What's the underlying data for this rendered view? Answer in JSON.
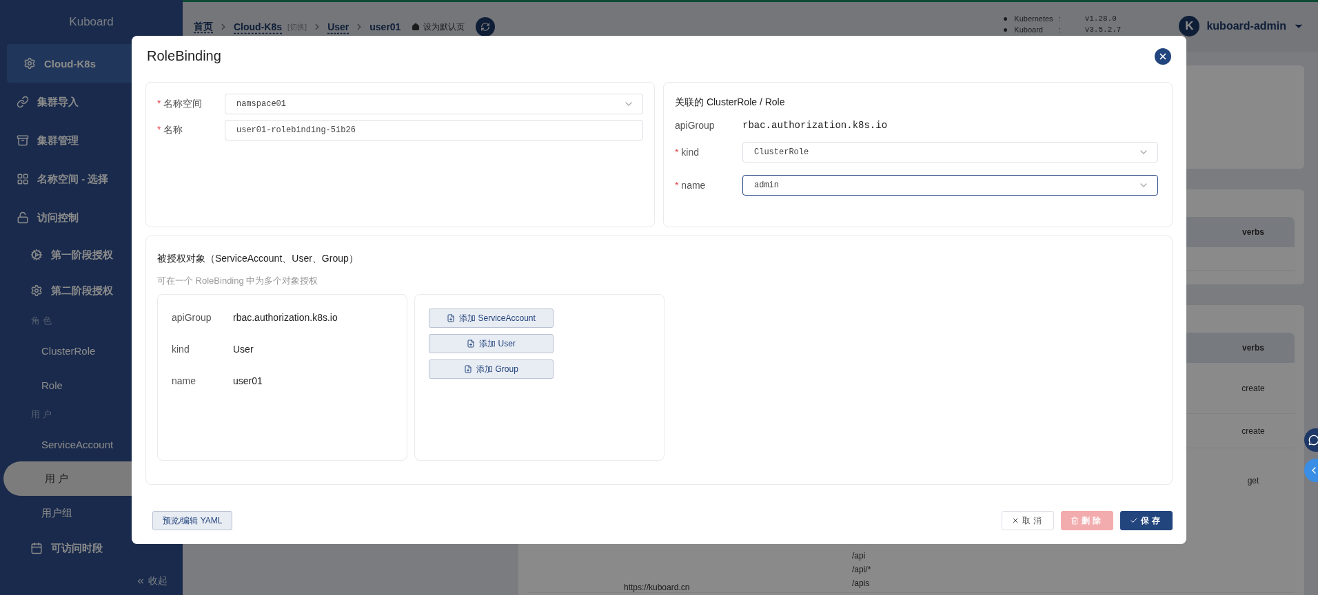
{
  "sidebar": {
    "title": "Kuboard",
    "items": [
      {
        "kind": "section",
        "label": "Cloud-K8s",
        "selected": true
      },
      {
        "kind": "section",
        "label": "集群导入",
        "selected": false
      },
      {
        "kind": "section",
        "label": "集群管理",
        "selected": false
      },
      {
        "kind": "section",
        "label": "名称空间 - 选择",
        "selected": false
      },
      {
        "kind": "section",
        "label": "访问控制",
        "selected": false
      },
      {
        "kind": "sub",
        "label": "第一阶段授权",
        "selected": false
      },
      {
        "kind": "sub",
        "label": "第二阶段授权",
        "selected": false
      },
      {
        "kind": "group",
        "label": "角 色"
      },
      {
        "kind": "leaf",
        "label": "ClusterRole",
        "selected": false
      },
      {
        "kind": "leaf",
        "label": "Role",
        "selected": false
      },
      {
        "kind": "group",
        "label": "用 户"
      },
      {
        "kind": "leaf",
        "label": "ServiceAccount",
        "selected": false
      },
      {
        "kind": "leaf",
        "label": "用 户",
        "selected": true
      },
      {
        "kind": "leaf",
        "label": "用户组",
        "selected": false
      },
      {
        "kind": "sub",
        "label": "可访问时段",
        "selected": false
      }
    ],
    "collapse": "收起"
  },
  "topbar": {
    "breadcrumb": [
      {
        "label": "首页",
        "current": false
      },
      {
        "label": "Cloud-K8s",
        "tag": "[切换]",
        "current": false
      },
      {
        "label": "User",
        "current": false
      },
      {
        "label": "user01",
        "current": true
      }
    ],
    "set_default": "设为默认页",
    "versions": [
      {
        "name": "Kubernetes",
        "sep": ":",
        "value": "v1.28.0"
      },
      {
        "name": "Kuboard",
        "sep": ":",
        "value": "v3.5.2.7"
      }
    ],
    "user": {
      "initial": "K",
      "name": "kuboard-admin"
    }
  },
  "background": {
    "tables": [
      {
        "header": "verbs"
      },
      {
        "header": "verbs",
        "rows": [
          {
            "verb": "create"
          },
          {
            "verb": "create"
          },
          {
            "verb": "get",
            "resources": [
              "/api",
              "/api/*",
              "/apis"
            ]
          }
        ]
      }
    ],
    "footer": "https://kuboard.cn"
  },
  "dialog": {
    "title": "RoleBinding",
    "meta_fields": [
      {
        "mark": "*",
        "label": "名称空间",
        "kind": "select",
        "value": "namspace01",
        "focused": false
      },
      {
        "mark": "*",
        "label": "名称",
        "kind": "input",
        "value": "user01-rolebinding-5ib26",
        "focused": false
      }
    ],
    "role_ref": {
      "title": "关联的 ClusterRole / Role",
      "fields": [
        {
          "label": "apiGroup",
          "kind": "text",
          "value": "rbac.authorization.k8s.io"
        },
        {
          "mark": "*",
          "label": "kind",
          "kind": "select",
          "value": "ClusterRole",
          "focused": false
        },
        {
          "mark": "*",
          "label": "name",
          "kind": "select",
          "value": "admin",
          "focused": true
        }
      ]
    },
    "subjects": {
      "title": "被授权对象（ServiceAccount、User、Group）",
      "hint": "可在一个 RoleBinding 中为多个对象授权",
      "items": [
        {
          "fields": [
            {
              "label": "apiGroup",
              "value": "rbac.authorization.k8s.io"
            },
            {
              "label": "kind",
              "value": "User"
            },
            {
              "label": "name",
              "value": "user01"
            }
          ]
        }
      ],
      "add_buttons": [
        "添加 ServiceAccount",
        "添加 User",
        "添加 Group"
      ]
    },
    "footer": {
      "yaml_button": "预览/编辑 YAML",
      "actions": [
        {
          "label": "取消",
          "kind": "cancel",
          "disabled": false
        },
        {
          "label": "删除",
          "kind": "delete",
          "disabled": true
        },
        {
          "label": "保存",
          "kind": "save",
          "disabled": false
        }
      ]
    }
  }
}
